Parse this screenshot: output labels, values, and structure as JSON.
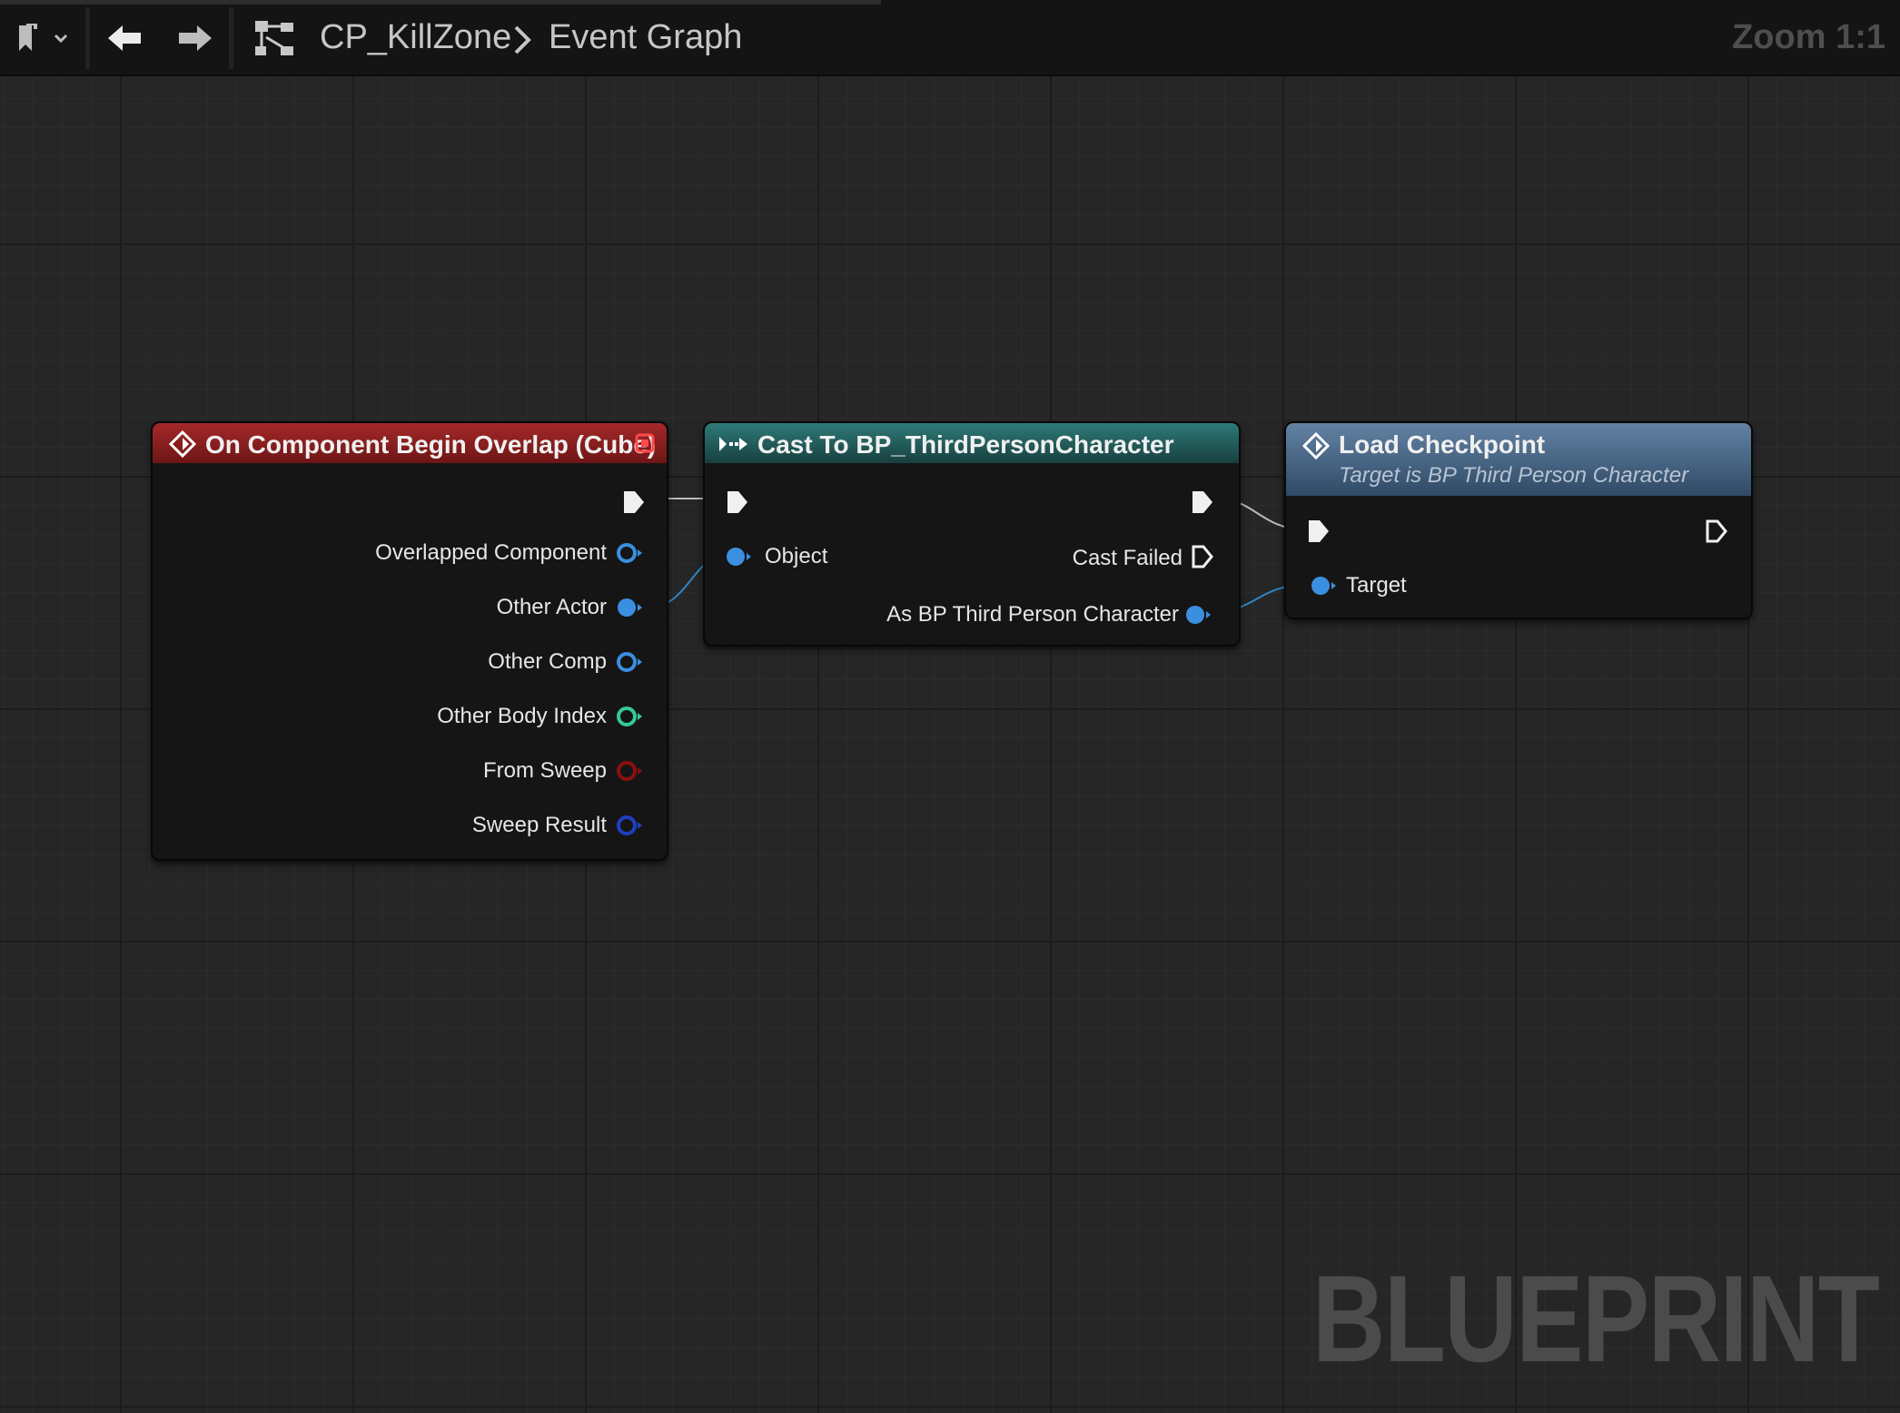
{
  "toolbar": {
    "breadcrumb_blueprint": "CP_KillZone",
    "breadcrumb_graph": "Event Graph",
    "zoom": "Zoom 1:1"
  },
  "watermark": "BLUEPRINT",
  "nodes": {
    "overlap_event": {
      "title": "On Component Begin Overlap (Cube)",
      "pins": [
        "Overlapped Component",
        "Other Actor",
        "Other Comp",
        "Other Body Index",
        "From Sweep",
        "Sweep Result"
      ]
    },
    "cast_node": {
      "title": "Cast To BP_ThirdPersonCharacter",
      "object_pin": "Object",
      "cast_failed_pin": "Cast Failed",
      "as_pin": "As BP Third Person Character"
    },
    "load_checkpoint": {
      "title": "Load Checkpoint",
      "subtitle": "Target is BP Third Person Character",
      "target_pin": "Target"
    }
  },
  "colors": {
    "event_header": "#8a1e1e",
    "cast_header": "#24605f",
    "function_header": "#4d6a88",
    "object_pin": "#3b8fe0",
    "int_pin": "#35c99c",
    "bool_pin": "#8a1010",
    "struct_pin": "#1f3fc0",
    "exec_pin": "#f0f0f0"
  }
}
